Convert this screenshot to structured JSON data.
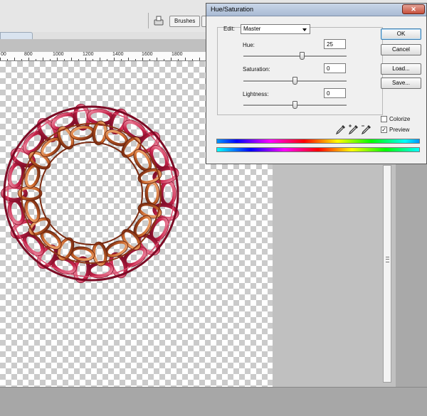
{
  "toolbar": {
    "brushes_tab": "Brushes"
  },
  "ruler": {
    "labels": [
      "00",
      "800",
      "1000",
      "1200",
      "1400",
      "1600",
      "1800"
    ]
  },
  "dialog": {
    "title": "Hue/Saturation",
    "close_icon": "close-icon",
    "edit_label": "Edit:",
    "edit_value": "Master",
    "hue_label": "Hue:",
    "hue_value": "25",
    "saturation_label": "Saturation:",
    "saturation_value": "0",
    "lightness_label": "Lightness:",
    "lightness_value": "0",
    "ok_label": "OK",
    "cancel_label": "Cancel",
    "load_label": "Load...",
    "save_label": "Save...",
    "colorize_label": "Colorize",
    "colorize_checked": false,
    "preview_label": "Preview",
    "preview_checked": true
  },
  "sliders": {
    "hue_value": 25,
    "saturation_value": 0,
    "lightness_value": 0
  },
  "colors": {
    "titlebar": "#b9c9df",
    "close": "#c7503c",
    "chain_dark": "#8b0d2a",
    "chain_light": "#e8758f",
    "chain_orange": "#c9652a"
  }
}
